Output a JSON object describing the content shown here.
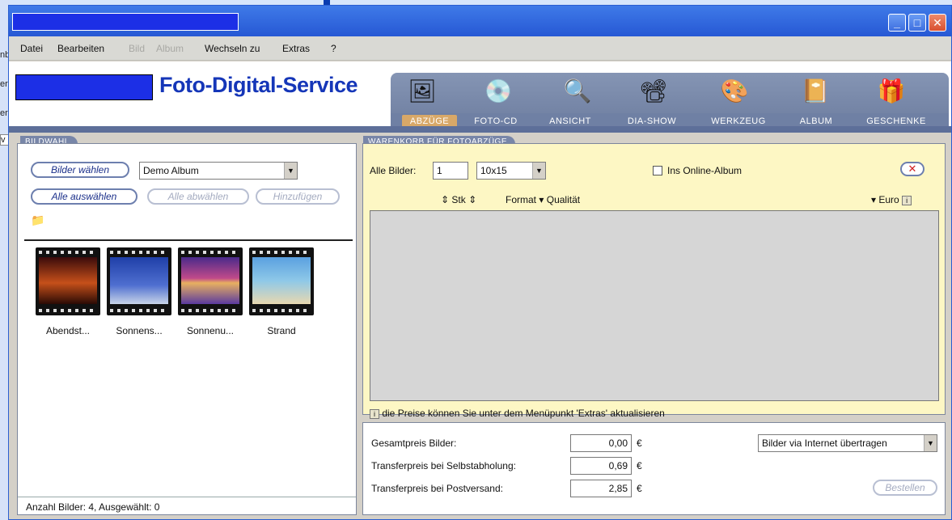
{
  "menu": [
    "Datei",
    "Bearbeiten",
    "Bild",
    "Album",
    "Wechseln zu",
    "Extras",
    "?"
  ],
  "menu_disabled": [
    false,
    false,
    true,
    true,
    false,
    false,
    false
  ],
  "window_buttons": {
    "minimize": "_",
    "maximize": "□",
    "close": "✕"
  },
  "brand": "Foto-Digital-Service",
  "nav_tabs": [
    "ABZÜGE",
    "FOTO-CD",
    "ANSICHT",
    "DIA-SHOW",
    "WERKZEUG",
    "ALBUM",
    "GESCHENKE"
  ],
  "active_tab": "ABZÜGE",
  "left_panel": {
    "tab": "BILDWAHL",
    "choose_button": "Bilder wählen",
    "album_select": "Demo Album",
    "select_all": "Alle auswählen",
    "deselect_all": "Alle abwählen",
    "add": "Hinzufügen",
    "images": [
      "Abendst...",
      "Sonnens...",
      "Sonnenu...",
      "Strand"
    ],
    "status": "Anzahl Bilder: 4, Ausgewählt: 0"
  },
  "cart": {
    "tab": "WARENKORB FÜR FOTOABZÜGE",
    "all_images_label": "Alle Bilder:",
    "qty": "1",
    "format": "10x15",
    "online_album": "Ins Online-Album",
    "col_stk": "Stk",
    "col_format": "Format",
    "col_quality": "Qualität",
    "col_euro": "Euro",
    "info": "die Preise können Sie unter dem Menüpunkt 'Extras' aktualisieren"
  },
  "totals": {
    "gesamt_label": "Gesamtpreis Bilder:",
    "gesamt": "0,00",
    "selbst_label": "Transferpreis bei Selbstabholung:",
    "selbst": "0,69",
    "post_label": "Transferpreis bei Postversand:",
    "post": "2,85",
    "currency": "€",
    "transfer_select": "Bilder via Internet übertragen",
    "order_button": "Bestellen"
  }
}
